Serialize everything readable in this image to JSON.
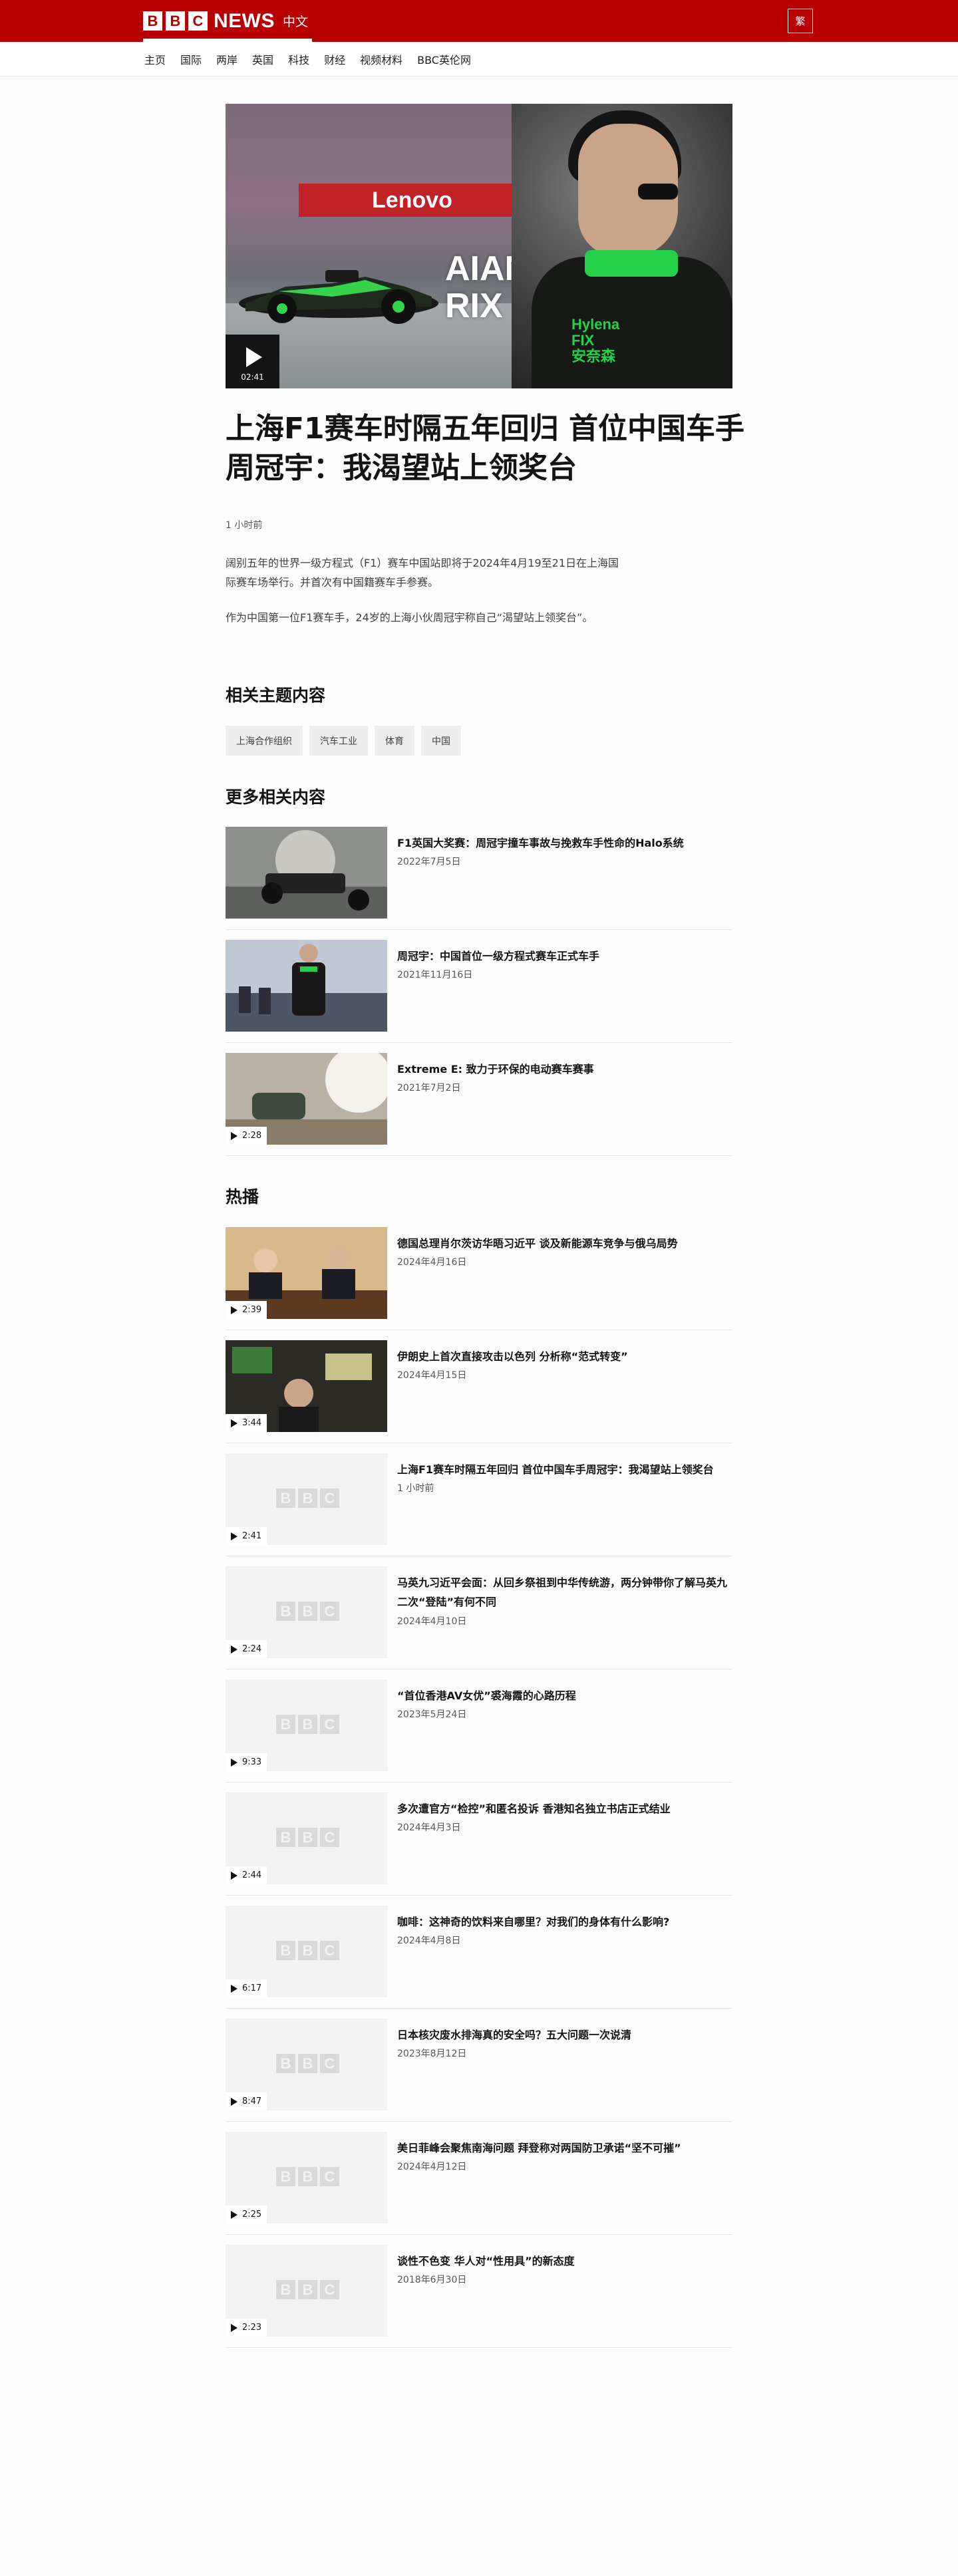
{
  "header": {
    "logo_letters": [
      "B",
      "B",
      "C"
    ],
    "logo_news": "NEWS",
    "logo_language": "中文",
    "traditional_button": "繁"
  },
  "nav": [
    "主页",
    "国际",
    "两岸",
    "英国",
    "科技",
    "财经",
    "视频材料",
    "BBC英伦网"
  ],
  "hero": {
    "duration": "02:41",
    "banner_text": "Lenovo",
    "sign_text": "AIAN\nRIX",
    "suit_text": "Hylena\nFIX\n安奈森"
  },
  "article": {
    "headline": "上海F1赛车时隔五年回归 首位中国车手周冠宇：我渴望站上领奖台",
    "timestamp": "1 小时前",
    "paragraphs": [
      "阔别五年的世界一级方程式（F1）赛车中国站即将于2024年4月19至21日在上海国际赛车场举行。并首次有中国籍赛车手参赛。",
      "作为中国第一位F1赛车手，24岁的上海小伙周冠宇称自己“渴望站上领奖台”。"
    ]
  },
  "related_topics": {
    "heading": "相关主题内容",
    "tags": [
      "上海合作组织",
      "汽车工业",
      "体育",
      "中国"
    ]
  },
  "more_related": {
    "heading": "更多相关内容",
    "items": [
      {
        "title": "F1英国大奖赛：周冠宇撞车事故与挽救车手性命的Halo系统",
        "date": "2022年7月5日",
        "duration": ""
      },
      {
        "title": "周冠宇：中国首位一级方程式赛车正式车手",
        "date": "2021年11月16日",
        "duration": ""
      },
      {
        "title": "Extreme E: 致力于环保的电动赛车赛事",
        "date": "2021年7月2日",
        "duration": "2:28"
      }
    ]
  },
  "popular": {
    "heading": "热播",
    "items": [
      {
        "title": "德国总理肖尔茨访华晤习近平 谈及新能源车竞争与俄乌局势",
        "date": "2024年4月16日",
        "duration": "2:39"
      },
      {
        "title": "伊朗史上首次直接攻击以色列 分析称“范式转变”",
        "date": "2024年4月15日",
        "duration": "3:44"
      },
      {
        "title": "上海F1赛车时隔五年回归 首位中国车手周冠宇：我渴望站上领奖台",
        "date": "1 小时前",
        "duration": "2:41"
      },
      {
        "title": "马英九习近平会面：从回乡祭祖到中华传统游，两分钟带你了解马英九二次“登陆”有何不同",
        "date": "2024年4月10日",
        "duration": "2:24"
      },
      {
        "title": "“首位香港AV女优”裘海霞的心路历程",
        "date": "2023年5月24日",
        "duration": "9:33"
      },
      {
        "title": "多次遭官方“检控”和匿名投诉 香港知名独立书店正式结业",
        "date": "2024年4月3日",
        "duration": "2:44"
      },
      {
        "title": "咖啡：这神奇的饮料来自哪里？对我们的身体有什么影响?",
        "date": "2024年4月8日",
        "duration": "6:17"
      },
      {
        "title": "日本核灾废水排海真的安全吗？五大问题一次说清",
        "date": "2023年8月12日",
        "duration": "8:47"
      },
      {
        "title": "美日菲峰会聚焦南海问题 拜登称对两国防卫承诺“坚不可摧”",
        "date": "2024年4月12日",
        "duration": "2:25"
      },
      {
        "title": "谈性不色变 华人对“性用具”的新态度",
        "date": "2018年6月30日",
        "duration": "2:23"
      }
    ]
  },
  "colors": {
    "brand_red": "#b80000",
    "text": "#141414",
    "muted": "#545658"
  }
}
